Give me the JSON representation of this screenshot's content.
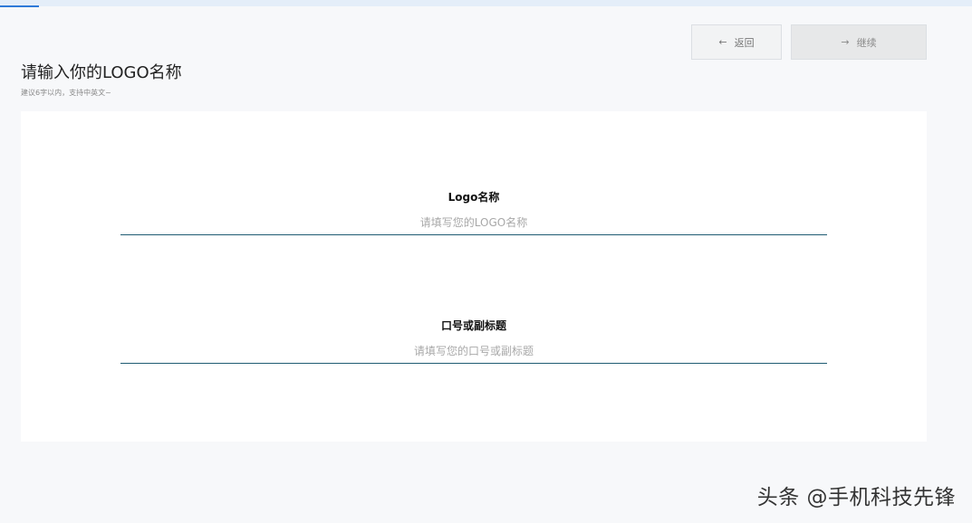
{
  "progress": {
    "fraction": 0.04
  },
  "toolbar": {
    "back_icon": "←",
    "back_label": "返回",
    "continue_icon": "→",
    "continue_label": "继续"
  },
  "header": {
    "title": "请输入你的LOGO名称",
    "subtitle": "建议6字以内，支持中英文~"
  },
  "form": {
    "logo_name": {
      "label": "Logo名称",
      "value": "",
      "placeholder": "请填写您的LOGO名称"
    },
    "slogan": {
      "label": "口号或副标题",
      "value": "",
      "placeholder": "请填写您的口号或副标题"
    }
  },
  "watermark": {
    "text": "头条 @手机科技先锋"
  },
  "colors": {
    "accent": "#2f7ad8",
    "input_underline": "#1f5c73",
    "page_background": "#f7f8fa",
    "card_background": "#ffffff"
  }
}
